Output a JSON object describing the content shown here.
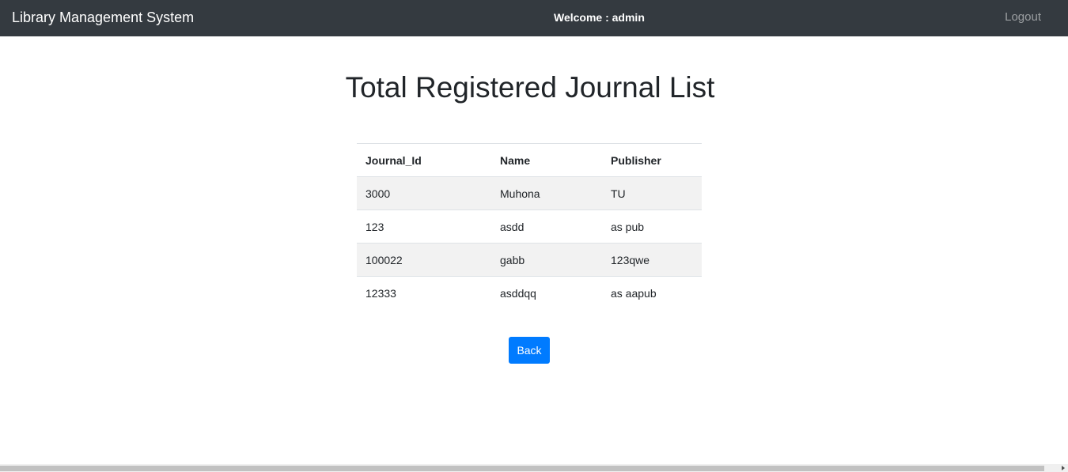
{
  "navbar": {
    "brand": "Library Management System",
    "welcome": "Welcome : admin",
    "logout": "Logout"
  },
  "page": {
    "title": "Total Registered Journal List"
  },
  "table": {
    "headers": [
      "Journal_Id",
      "Name",
      "Publisher"
    ],
    "rows": [
      [
        "3000",
        "Muhona",
        "TU"
      ],
      [
        "123",
        "asdd",
        "as pub"
      ],
      [
        "100022",
        "gabb",
        "123qwe"
      ],
      [
        "12333",
        "asddqq",
        "as aapub"
      ]
    ]
  },
  "actions": {
    "back": "Back"
  },
  "colors": {
    "navbar_bg": "#343a40",
    "primary": "#007bff",
    "stripe": "#f2f2f2"
  }
}
